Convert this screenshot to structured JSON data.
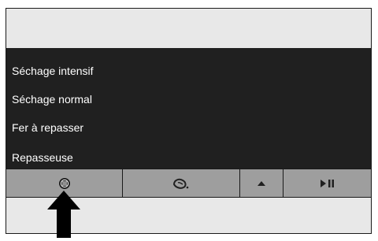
{
  "menu": {
    "items": [
      {
        "label": "Séchage intensif"
      },
      {
        "label": "Séchage normal"
      },
      {
        "label": "Fer à repasser"
      },
      {
        "label": "Repasseuse"
      }
    ]
  },
  "toolbar": {
    "buttons": [
      {
        "icon": "dry-intensive-icon"
      },
      {
        "icon": "steam-drop-icon"
      },
      {
        "icon": "scroll-up-triangle-icon"
      },
      {
        "icon": "play-pause-icon"
      }
    ]
  },
  "annotation": {
    "icon": "pointer-arrow-icon"
  },
  "colors": {
    "menu_background": "#202020",
    "menu_text": "#ffffff",
    "toolbar_background": "#9e9e9e",
    "panel_background": "#e8e8e8",
    "border": "#1a1a1a"
  }
}
